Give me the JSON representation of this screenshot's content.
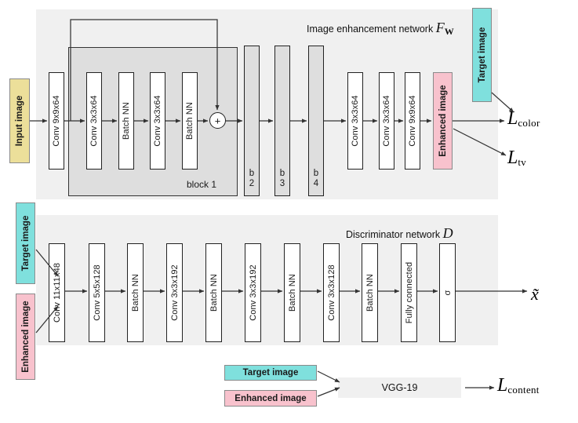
{
  "figure": {
    "enhancement_network": {
      "title_text": "Image enhancement network",
      "title_symbol": "F",
      "title_symbol_sub": "W",
      "input_chip": "Input image",
      "output_chip": "Enhanced image",
      "target_chip": "Target image",
      "block_label": "block 1",
      "head_layers": [
        {
          "label": "Conv 9x9x64"
        }
      ],
      "residual_layers": [
        {
          "label": "Conv 3x3x64"
        },
        {
          "label": "Batch NN"
        },
        {
          "label": "Conv 3x3x64"
        },
        {
          "label": "Batch NN"
        }
      ],
      "sum_node": "+",
      "repeat_blocks": [
        {
          "label": "b\n2"
        },
        {
          "label": "b\n3"
        },
        {
          "label": "b\n4"
        }
      ],
      "tail_layers": [
        {
          "label": "Conv 3x3x64"
        },
        {
          "label": "Conv 3x3x64"
        },
        {
          "label": "Conv 9x9x64"
        }
      ],
      "losses": [
        {
          "symbol": "L",
          "subscript": "color"
        },
        {
          "symbol": "L",
          "subscript": "tv"
        }
      ]
    },
    "discriminator_network": {
      "title_text": "Discriminator network",
      "title_symbol": "D",
      "input_chips": [
        {
          "label": "Target image",
          "color_key": "teal"
        },
        {
          "label": "Enhanced image",
          "color_key": "pink"
        }
      ],
      "layers": [
        {
          "label": "Conv 11x11x48"
        },
        {
          "label": "Conv 5x5x128"
        },
        {
          "label": "Batch NN"
        },
        {
          "label": "Conv 3x3x192"
        },
        {
          "label": "Batch NN"
        },
        {
          "label": "Conv 3x3x192"
        },
        {
          "label": "Batch NN"
        },
        {
          "label": "Conv 3x3x128"
        },
        {
          "label": "Batch NN"
        },
        {
          "label": "Fully connected"
        },
        {
          "label": "σ"
        }
      ],
      "output_symbol": "x̃"
    },
    "content_network": {
      "input_chips": [
        {
          "label": "Target image",
          "color_key": "teal"
        },
        {
          "label": "Enhanced image",
          "color_key": "pink"
        }
      ],
      "model_label": "VGG-19",
      "loss": {
        "symbol": "L",
        "subscript": "content"
      }
    },
    "colors": {
      "yellow": "#ecdf9a",
      "teal": "#7fe0dd",
      "pink": "#f8c2cd",
      "panel_bg": "#f0f0f0",
      "block_bg": "#dedede",
      "layer_bg": "#ffffff",
      "stroke": "#222222",
      "text": "#1a1a1a"
    }
  }
}
